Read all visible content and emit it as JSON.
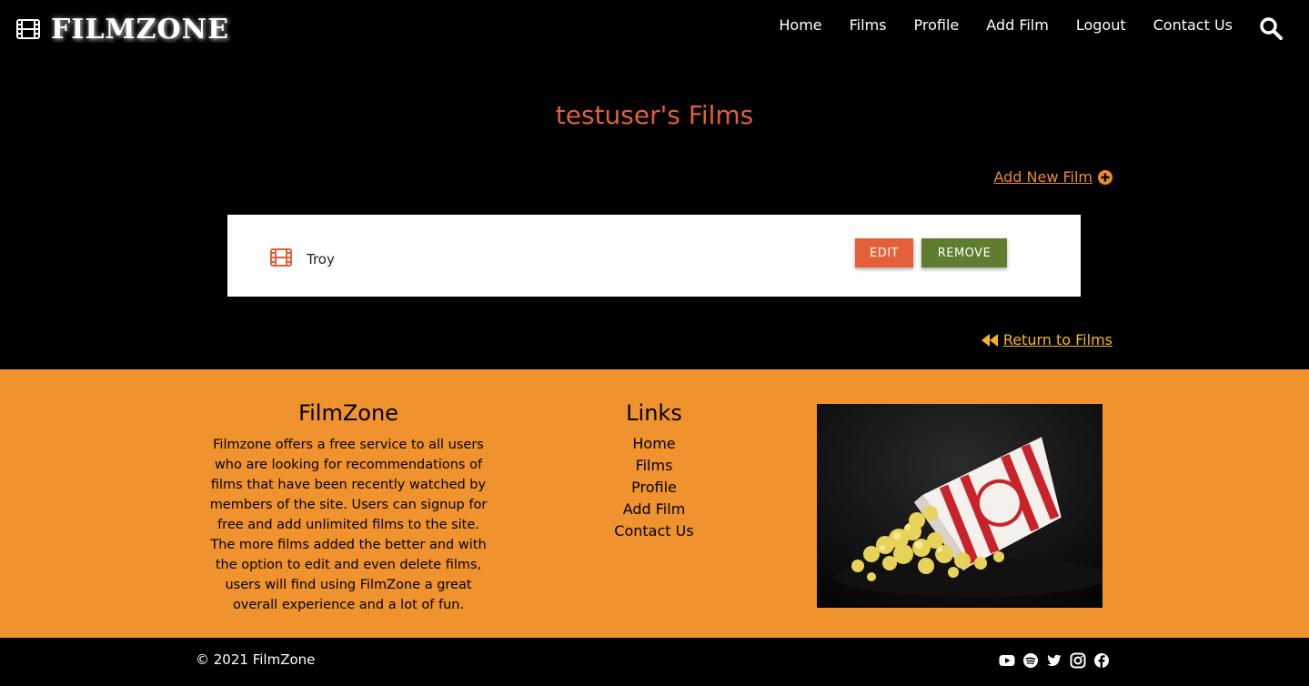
{
  "brand": {
    "name": "FILMZONE"
  },
  "nav": {
    "items": [
      "Home",
      "Films",
      "Profile",
      "Add Film",
      "Logout",
      "Contact Us"
    ]
  },
  "page": {
    "title": "testuser's Films",
    "add_link": "Add New Film",
    "return_link": "Return to Films"
  },
  "films": [
    {
      "title": "Troy",
      "edit_label": "EDIT",
      "remove_label": "REMOVE"
    }
  ],
  "footer": {
    "about_title": "FilmZone",
    "about_text": "Filmzone offers a free service to all users who are looking for recommendations of films that have been recently watched by members of the site. Users can signup for free and add unlimited films to the site. The more films added the better and with the option to edit and even delete films, users will find using FilmZone a great overall experience and a lot of fun.",
    "links_title": "Links",
    "links": [
      "Home",
      "Films",
      "Profile",
      "Add Film",
      "Contact Us"
    ],
    "copyright": "© 2021 FilmZone",
    "socials": [
      "youtube-icon",
      "spotify-icon",
      "twitter-icon",
      "instagram-icon",
      "facebook-icon"
    ]
  },
  "colors": {
    "accent": "#e0603a",
    "link_orange": "#f08a2b",
    "return_yellow": "#f2b824",
    "footer_bg": "#f0922d",
    "edit_button": "#e4603a",
    "remove_button": "#5e7d2f"
  }
}
